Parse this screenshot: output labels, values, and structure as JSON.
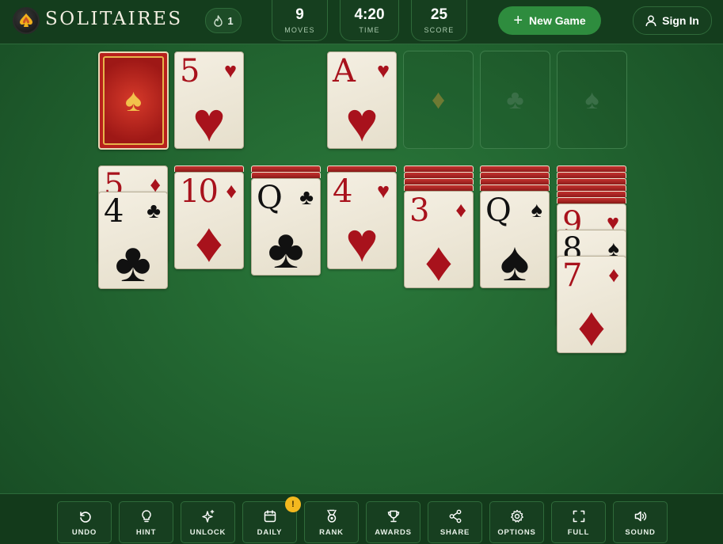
{
  "header": {
    "logo_text": "SOLITAIRES",
    "streak_count": "1",
    "moves": {
      "value": "9",
      "label": "MOVES"
    },
    "time": {
      "value": "4:20",
      "label": "TIME"
    },
    "score": {
      "value": "25",
      "label": "SCORE"
    },
    "new_game_label": "New Game",
    "sign_in_label": "Sign In"
  },
  "top_row": {
    "waste_card": {
      "rank": "5",
      "suit": "♥",
      "color": "red"
    },
    "foundations": [
      {
        "rank": "A",
        "suit": "♥",
        "color": "red"
      },
      {
        "placeholder_suit": "♦",
        "placeholder_color": "#6e7a33"
      },
      {
        "placeholder_suit": "♣",
        "placeholder_color": "#3a6f47"
      },
      {
        "placeholder_suit": "♠",
        "placeholder_color": "#3a6f47"
      }
    ]
  },
  "tableau": [
    {
      "hidden": 0,
      "cards": [
        {
          "rank": "5",
          "suit": "♦",
          "color": "red"
        },
        {
          "rank": "4",
          "suit": "♣",
          "color": "black"
        }
      ]
    },
    {
      "hidden": 1,
      "cards": [
        {
          "rank": "10",
          "suit": "♦",
          "color": "red"
        }
      ]
    },
    {
      "hidden": 2,
      "cards": [
        {
          "rank": "Q",
          "suit": "♣",
          "color": "black"
        }
      ]
    },
    {
      "hidden": 1,
      "cards": [
        {
          "rank": "4",
          "suit": "♥",
          "color": "red"
        }
      ]
    },
    {
      "hidden": 4,
      "cards": [
        {
          "rank": "3",
          "suit": "♦",
          "color": "red"
        }
      ]
    },
    {
      "hidden": 4,
      "cards": [
        {
          "rank": "Q",
          "suit": "♠",
          "color": "black"
        }
      ]
    },
    {
      "hidden": 6,
      "cards": [
        {
          "rank": "9",
          "suit": "♥",
          "color": "red"
        },
        {
          "rank": "8",
          "suit": "♠",
          "color": "black"
        },
        {
          "rank": "7",
          "suit": "♦",
          "color": "red"
        }
      ]
    }
  ],
  "toolbar": {
    "undo": "UNDO",
    "hint": "HINT",
    "unlock": "UNLOCK",
    "daily": "DAILY",
    "daily_badge": "!",
    "rank": "RANK",
    "awards": "AWARDS",
    "share": "SHARE",
    "options": "OPTIONS",
    "full": "FULL",
    "sound": "SOUND"
  },
  "colors": {
    "felt": "#20602e",
    "red_suit": "#a8121c",
    "black_suit": "#111111",
    "accent_green": "#2e8c3e",
    "badge_yellow": "#f3b81f"
  }
}
